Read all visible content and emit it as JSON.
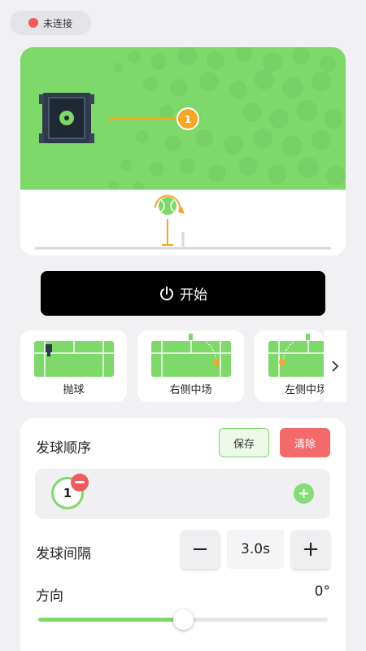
{
  "status": {
    "label": "未连接",
    "dot_color": "#f05a5a"
  },
  "court": {
    "ball_marker": "1",
    "machine_icon": "ball-machine-icon",
    "ball_icon": "tennis-ball-spin-icon"
  },
  "start_button": {
    "label": "开始",
    "icon": "power-icon"
  },
  "modes": [
    {
      "label": "抛球",
      "icon": "court-toss-icon"
    },
    {
      "label": "右侧中场",
      "icon": "court-right-mid-icon"
    },
    {
      "label": "左侧中场",
      "icon": "court-left-mid-icon"
    }
  ],
  "modes_next_icon": "chevron-right-icon",
  "settings": {
    "sequence_title": "发球顺序",
    "save_label": "保存",
    "clear_label": "清除",
    "sequence_items": [
      "1"
    ],
    "interval_title": "发球间隔",
    "interval_value": "3.0s",
    "minus_label": "−",
    "plus_label": "+",
    "direction_title": "方向",
    "direction_value": "0°",
    "direction_fraction": 0.5
  },
  "colors": {
    "accent_green": "#7fd86a",
    "danger_red": "#f26a6a",
    "marker_orange": "#f5a623"
  }
}
